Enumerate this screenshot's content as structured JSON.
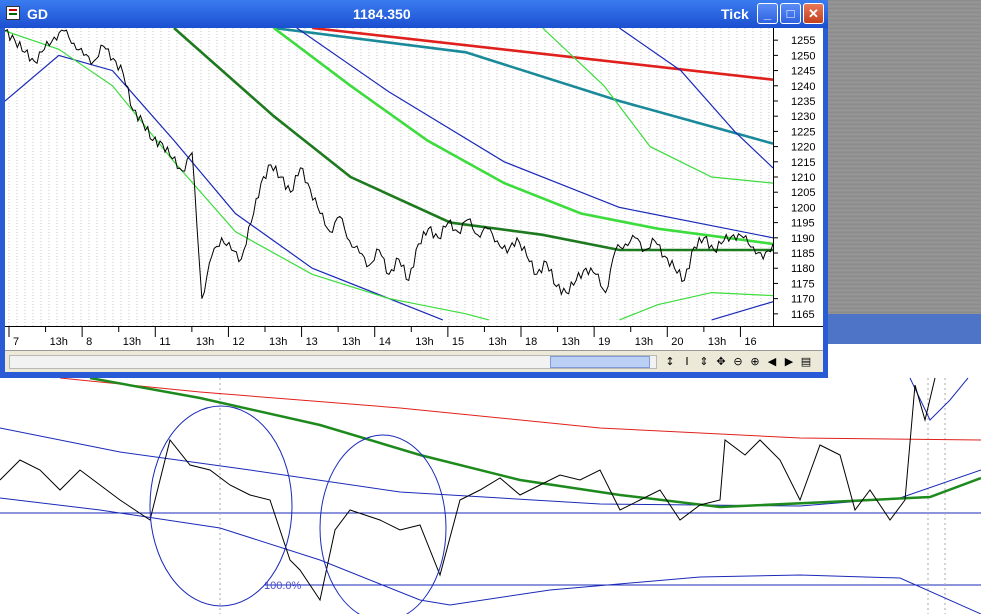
{
  "window": {
    "symbol": "GD",
    "price": "1184.350",
    "timeframe": "Tick",
    "minimize": "_",
    "maximize": "□",
    "close": "✕"
  },
  "toolbar": {
    "tools": [
      "↕",
      "I",
      "⇕",
      "✥",
      "⊖",
      "⊕",
      "◀",
      "▶",
      "▤"
    ],
    "tool_names": [
      "refresh-icon",
      "cursor-icon",
      "vertical-resize-icon",
      "pan-icon",
      "zoom-out-icon",
      "zoom-in-icon",
      "scroll-left-icon",
      "scroll-right-icon",
      "window-icon"
    ]
  },
  "bottom_chart": {
    "fib_label": "100.0%"
  },
  "chart_data": {
    "type": "line",
    "title": "",
    "ylim": [
      1161,
      1259
    ],
    "yticks": [
      1165,
      1170,
      1175,
      1180,
      1185,
      1190,
      1195,
      1200,
      1205,
      1210,
      1215,
      1220,
      1225,
      1230,
      1235,
      1240,
      1245,
      1250,
      1255
    ],
    "grid": "vertical dotted",
    "xtick_labels": [
      {
        "label": "7",
        "major": true
      },
      {
        "label": "13h",
        "major": false
      },
      {
        "label": "8",
        "major": true
      },
      {
        "label": "13h",
        "major": false
      },
      {
        "label": "11",
        "major": true
      },
      {
        "label": "13h",
        "major": false
      },
      {
        "label": "12",
        "major": true
      },
      {
        "label": "13h",
        "major": false
      },
      {
        "label": "13",
        "major": true
      },
      {
        "label": "13h",
        "major": false
      },
      {
        "label": "14",
        "major": true
      },
      {
        "label": "13h",
        "major": false
      },
      {
        "label": "15",
        "major": true
      },
      {
        "label": "13h",
        "major": false
      },
      {
        "label": "18",
        "major": true
      },
      {
        "label": "13h",
        "major": false
      },
      {
        "label": "19",
        "major": true
      },
      {
        "label": "13h",
        "major": false
      },
      {
        "label": "20",
        "major": true
      },
      {
        "label": "13h",
        "major": false
      },
      {
        "label": "16",
        "major": true
      }
    ],
    "price_series": {
      "name": "price",
      "color": "#000000",
      "x": [
        0,
        1,
        2,
        3,
        4,
        5,
        6,
        7,
        8,
        9,
        10,
        11,
        12,
        13,
        14,
        15,
        16,
        17,
        18,
        19,
        20,
        21,
        22,
        23,
        24,
        25,
        26,
        27,
        28,
        29,
        30,
        31,
        32,
        33,
        34,
        35,
        36,
        37,
        38,
        39,
        40,
        41,
        42,
        43,
        44,
        45,
        46,
        47,
        48,
        49,
        50,
        51,
        52,
        53,
        54,
        55,
        56,
        57,
        58,
        59,
        60,
        61,
        62,
        63,
        64,
        65,
        66,
        67,
        68,
        69,
        70,
        71,
        72,
        73,
        74,
        75,
        76,
        77,
        78,
        79,
        80,
        81,
        82,
        83,
        84,
        85,
        86,
        87,
        88,
        89,
        90,
        91,
        92,
        93,
        94,
        95,
        96,
        97,
        98,
        99,
        100
      ],
      "y": [
        1258,
        1255,
        1251,
        1248,
        1252,
        1256,
        1258,
        1254,
        1250,
        1248,
        1253,
        1249,
        1244,
        1232,
        1228,
        1222,
        1221,
        1216,
        1212,
        1218,
        1170,
        1184,
        1190,
        1186,
        1183,
        1195,
        1208,
        1214,
        1210,
        1205,
        1213,
        1206,
        1198,
        1192,
        1197,
        1189,
        1185,
        1181,
        1186,
        1178,
        1183,
        1176,
        1188,
        1193,
        1190,
        1195,
        1192,
        1196,
        1191,
        1193,
        1189,
        1185,
        1190,
        1184,
        1178,
        1182,
        1174,
        1172,
        1176,
        1180,
        1178,
        1172,
        1186,
        1188,
        1190,
        1186,
        1189,
        1184,
        1180,
        1176,
        1187,
        1190,
        1186,
        1189,
        1191,
        1190,
        1187,
        1183,
        1188
      ],
      "note": "price trace sampled left to right"
    },
    "series": [
      {
        "name": "red",
        "color": "#e0201c",
        "x": [
          40,
          100
        ],
        "y": [
          1259,
          1242
        ]
      },
      {
        "name": "teal",
        "color": "#1a8a9a",
        "x": [
          35,
          60,
          80,
          100
        ],
        "y": [
          1259,
          1251,
          1235,
          1221
        ]
      },
      {
        "name": "dark-green",
        "color": "#1e7a1e",
        "x": [
          22,
          35,
          45,
          58,
          70,
          80,
          90,
          100
        ],
        "y": [
          1259,
          1230,
          1210,
          1195,
          1191,
          1186,
          1186,
          1186
        ]
      },
      {
        "name": "bright-green",
        "color": "#3cdc3c",
        "x": [
          35,
          45,
          55,
          65,
          75,
          85,
          100
        ],
        "y": [
          1259,
          1240,
          1222,
          1208,
          1198,
          1193,
          1188
        ]
      },
      {
        "name": "blue-mid",
        "color": "#1a2ab8",
        "x": [
          38,
          50,
          65,
          80,
          100
        ],
        "y": [
          1259,
          1238,
          1215,
          1200,
          1190
        ]
      },
      {
        "name": "blue-upper",
        "color": "#1a2ab8",
        "x": [
          80,
          88,
          95,
          100
        ],
        "y": [
          1259,
          1245,
          1225,
          1213
        ]
      },
      {
        "name": "green-thin-upper",
        "color": "#3cdc3c",
        "x": [
          70,
          78,
          84,
          92,
          100
        ],
        "y": [
          1259,
          1240,
          1220,
          1210,
          1208
        ]
      },
      {
        "name": "blue-lower",
        "color": "#1a2ab8",
        "x": [
          0,
          7,
          14,
          22,
          30,
          40,
          50,
          57
        ],
        "y": [
          1235,
          1250,
          1245,
          1222,
          1198,
          1180,
          1170,
          1163
        ]
      },
      {
        "name": "green-thin-lower",
        "color": "#3cdc3c",
        "x": [
          0,
          7,
          14,
          22,
          30,
          40,
          50,
          60,
          63
        ],
        "y": [
          1258,
          1252,
          1240,
          1215,
          1192,
          1178,
          1170,
          1165,
          1163
        ]
      },
      {
        "name": "green-thin-right",
        "color": "#3cdc3c",
        "x": [
          80,
          85,
          92,
          100
        ],
        "y": [
          1163,
          1168,
          1172,
          1171
        ]
      },
      {
        "name": "blue-right",
        "color": "#1a2ab8",
        "x": [
          92,
          96,
          100
        ],
        "y": [
          1163,
          1166,
          1169
        ]
      }
    ]
  }
}
